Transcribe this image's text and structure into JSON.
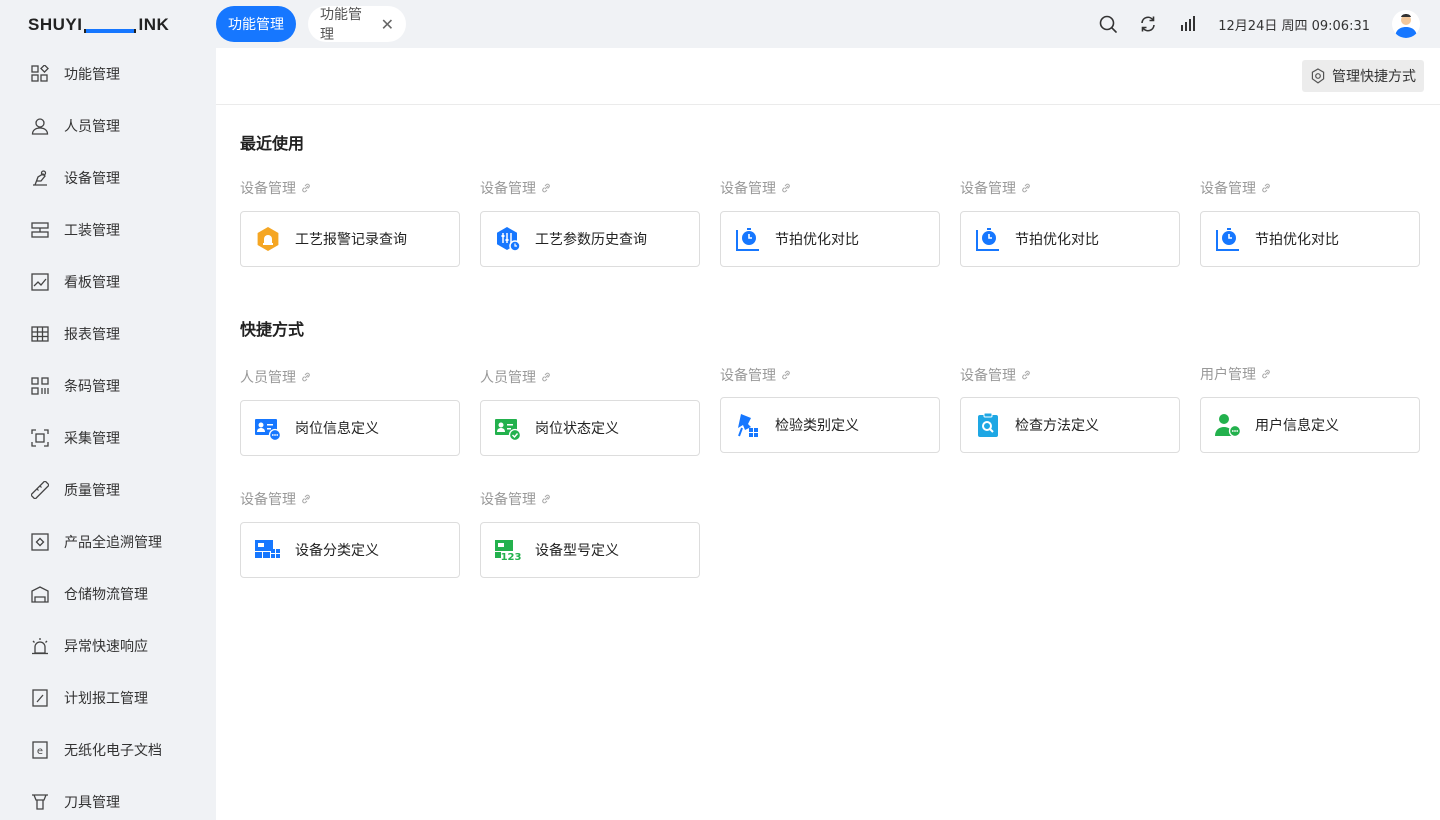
{
  "app": {
    "logo_left": "SHUYI",
    "logo_right": "INK"
  },
  "tabs": [
    {
      "label": "功能管理",
      "active": true
    },
    {
      "label": "功能管理",
      "active": false
    }
  ],
  "header": {
    "datetime": "12月24日 周四 09:06:31"
  },
  "sidebar": {
    "items": [
      {
        "label": "功能管理",
        "icon": "apps-icon"
      },
      {
        "label": "人员管理",
        "icon": "user-icon"
      },
      {
        "label": "设备管理",
        "icon": "machine-icon"
      },
      {
        "label": "工装管理",
        "icon": "fixture-icon"
      },
      {
        "label": "看板管理",
        "icon": "chart-icon"
      },
      {
        "label": "报表管理",
        "icon": "table-icon"
      },
      {
        "label": "条码管理",
        "icon": "barcode-icon"
      },
      {
        "label": "采集管理",
        "icon": "scan-icon"
      },
      {
        "label": "质量管理",
        "icon": "ruler-icon"
      },
      {
        "label": "产品全追溯管理",
        "icon": "trace-icon"
      },
      {
        "label": "仓储物流管理",
        "icon": "warehouse-icon"
      },
      {
        "label": "异常快速响应",
        "icon": "alarm-icon"
      },
      {
        "label": "计划报工管理",
        "icon": "plan-icon"
      },
      {
        "label": "无纸化电子文档",
        "icon": "document-icon"
      },
      {
        "label": "刀具管理",
        "icon": "tool-icon"
      }
    ]
  },
  "main": {
    "manage_shortcuts_label": "管理快捷方式",
    "recent": {
      "title": "最近使用",
      "items": [
        {
          "category": "设备管理",
          "label": "工艺报警记录查询",
          "icon": "alarm-hexagon-icon"
        },
        {
          "category": "设备管理",
          "label": "工艺参数历史查询",
          "icon": "parameter-history-icon"
        },
        {
          "category": "设备管理",
          "label": "节拍优化对比",
          "icon": "cycle-timer-icon"
        },
        {
          "category": "设备管理",
          "label": "节拍优化对比",
          "icon": "cycle-timer-icon"
        },
        {
          "category": "设备管理",
          "label": "节拍优化对比",
          "icon": "cycle-timer-icon"
        }
      ]
    },
    "shortcuts": {
      "title": "快捷方式",
      "items": [
        {
          "category": "人员管理",
          "label": "岗位信息定义",
          "icon": "position-info-icon"
        },
        {
          "category": "人员管理",
          "label": "岗位状态定义",
          "icon": "position-status-icon"
        },
        {
          "category": "设备管理",
          "label": "检验类别定义",
          "icon": "inspection-category-icon"
        },
        {
          "category": "设备管理",
          "label": "检查方法定义",
          "icon": "inspection-method-icon"
        },
        {
          "category": "用户管理",
          "label": "用户信息定义",
          "icon": "user-info-icon"
        },
        {
          "category": "设备管理",
          "label": "设备分类定义",
          "icon": "device-category-icon"
        },
        {
          "category": "设备管理",
          "label": "设备型号定义",
          "icon": "device-model-icon"
        }
      ]
    }
  },
  "colors": {
    "accent": "#1677ff",
    "green": "#23b14d",
    "orange": "#f5a623"
  }
}
